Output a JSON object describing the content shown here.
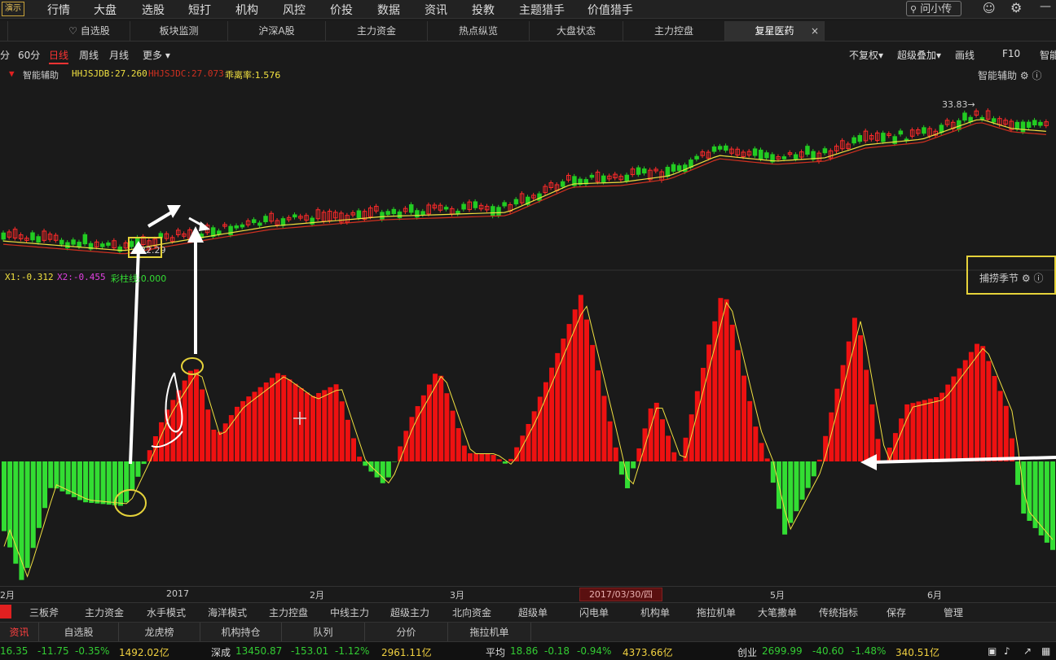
{
  "top_menu": {
    "demo_badge": "演示",
    "items": [
      "行情",
      "大盘",
      "选股",
      "短打",
      "机构",
      "风控",
      "价投",
      "数据",
      "资讯",
      "投教",
      "主题猎手",
      "价值猎手"
    ],
    "search_placeholder": "问小传"
  },
  "tabs": [
    {
      "label": "自选股",
      "icon": "heart-icon"
    },
    {
      "label": "板块监测"
    },
    {
      "label": "沪深A股"
    },
    {
      "label": "主力资金"
    },
    {
      "label": "热点纵览"
    },
    {
      "label": "大盘状态"
    },
    {
      "label": "主力控盘"
    },
    {
      "label": "复星医药",
      "active": true
    }
  ],
  "periods": [
    "分",
    "60分",
    "日线",
    "周线",
    "月线",
    "更多"
  ],
  "active_period": "日线",
  "right_tools": [
    "不复权",
    "超级叠加",
    "画线",
    "F10",
    "智能"
  ],
  "indicator": {
    "name": "智能辅助",
    "v1": "HHJSJDB:27.260",
    "v2": "HHJSJDC:27.073",
    "v3": "乖离率:1.576",
    "right_label": "智能辅助"
  },
  "price_labels": {
    "high": "33.83",
    "low": "22.29"
  },
  "sub_indicator": {
    "x1": "X1:-0.312",
    "x2": "X2:-0.455",
    "bar": "彩柱线:0.000",
    "panel_label": "捕捞季节"
  },
  "xaxis": {
    "ticks": [
      "2月",
      "2017",
      "2月",
      "3月",
      "5月",
      "6月"
    ],
    "cursor_date": "2017/03/30/四"
  },
  "indicator_tabs": [
    "三板斧",
    "主力资金",
    "水手模式",
    "海洋模式",
    "主力控盘",
    "中线主力",
    "超级主力",
    "北向资金",
    "超级单",
    "闪电单",
    "机构单",
    "拖拉机单",
    "大笔撒单",
    "传统指标",
    "保存",
    "管理"
  ],
  "bottom_tabs": [
    "资讯",
    "自选股",
    "龙虎榜",
    "机构持仓",
    "队列",
    "分价",
    "拖拉机单"
  ],
  "ticker": [
    {
      "price": "16.35",
      "chg": "-11.75",
      "pct": "-0.35%",
      "amt": "1492.02亿"
    },
    {
      "name": "深成",
      "price": "13450.87",
      "chg": "-153.01",
      "pct": "-1.12%",
      "amt": "2961.11亿"
    },
    {
      "name": "平均",
      "price": "18.86",
      "chg": "-0.18",
      "pct": "-0.94%",
      "amt": "4373.66亿"
    },
    {
      "name": "创业",
      "price": "2699.99",
      "chg": "-40.60",
      "pct": "-1.48%",
      "amt": "340.51亿"
    }
  ],
  "colors": {
    "up": "#ff2a2a",
    "down": "#22cc22",
    "ma_yellow": "#f0e040",
    "ma_red": "#d03020"
  }
}
